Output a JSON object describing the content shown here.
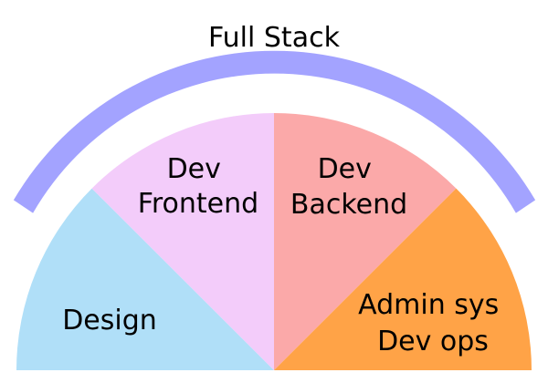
{
  "diagram": {
    "title": "Full Stack",
    "arc_color": "#a3a3ff",
    "sectors": [
      {
        "id": "design",
        "lines": [
          "Design"
        ],
        "color": "#b0dff8"
      },
      {
        "id": "dev-frontend",
        "lines": [
          "Dev",
          "Frontend"
        ],
        "color": "#f3ccfa"
      },
      {
        "id": "dev-backend",
        "lines": [
          "Dev",
          "Backend"
        ],
        "color": "#fba9a9"
      },
      {
        "id": "admin-devops",
        "lines": [
          "Admin sys",
          "Dev ops"
        ],
        "color": "#ffa347"
      }
    ]
  }
}
